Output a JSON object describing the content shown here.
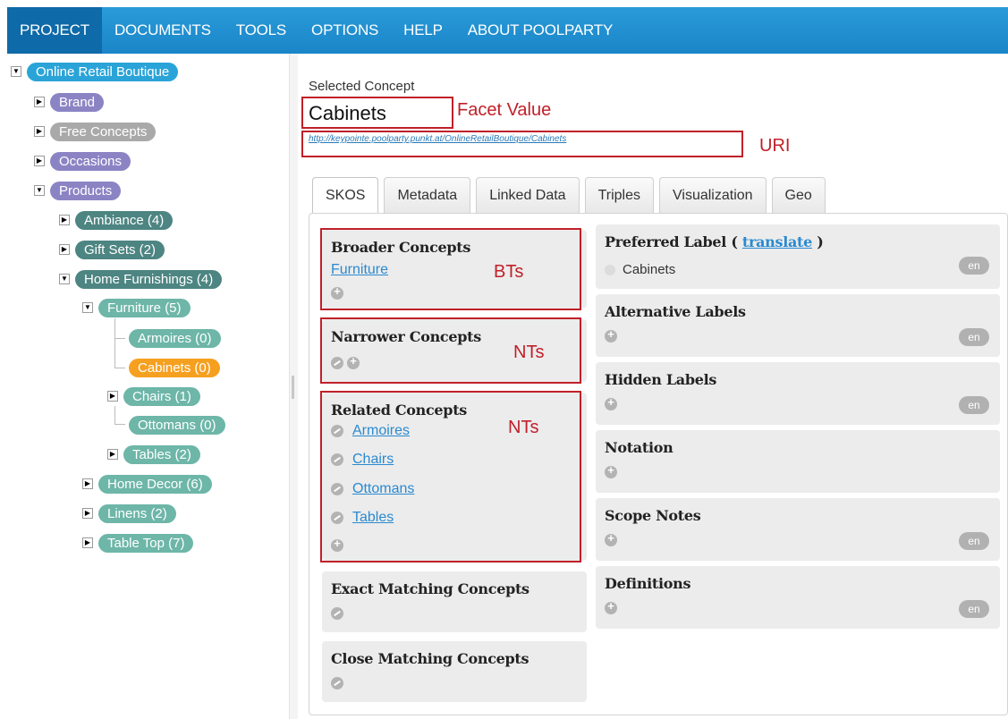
{
  "menu": [
    "PROJECT",
    "DOCUMENTS",
    "TOOLS",
    "OPTIONS",
    "HELP",
    "ABOUT POOLPARTY"
  ],
  "tree": {
    "root": "Online Retail Boutique",
    "brand": "Brand",
    "free": "Free Concepts",
    "occasions": "Occasions",
    "products": "Products",
    "ambiance": "Ambiance (4)",
    "gift_sets": "Gift Sets (2)",
    "home_furnishings": "Home Furnishings (4)",
    "furniture": "Furniture (5)",
    "armoires": "Armoires (0)",
    "cabinets": "Cabinets (0)",
    "chairs": "Chairs (1)",
    "ottomans": "Ottomans (0)",
    "tables": "Tables (2)",
    "home_decor": "Home Decor (6)",
    "linens": "Linens (2)",
    "table_top": "Table Top (7)"
  },
  "concept": {
    "selected_label": "Selected Concept",
    "title": "Cabinets",
    "uri": "http://keypointe.poolparty.punkt.at/OnlineRetailBoutique/Cabinets"
  },
  "annotations": {
    "facet": "Facet Value",
    "uri": "URI",
    "bts": "BTs",
    "nts1": "NTs",
    "nts2": "NTs"
  },
  "tabs": [
    "SKOS",
    "Metadata",
    "Linked Data",
    "Triples",
    "Visualization",
    "Geo"
  ],
  "left_cards": {
    "broader": {
      "title": "Broader Concepts",
      "items": [
        "Furniture"
      ]
    },
    "narrower": {
      "title": "Narrower Concepts"
    },
    "related": {
      "title": "Related Concepts",
      "items": [
        "Armoires",
        "Chairs",
        "Ottomans",
        "Tables"
      ]
    },
    "exact": {
      "title": "Exact Matching Concepts"
    },
    "close": {
      "title": "Close Matching Concepts"
    }
  },
  "right_cards": {
    "preferred": {
      "title_prefix": "Preferred Label ( ",
      "translate": "translate",
      "title_suffix": " )",
      "value": "Cabinets",
      "lang": "en"
    },
    "alternative": {
      "title": "Alternative Labels",
      "lang": "en"
    },
    "hidden": {
      "title": "Hidden Labels",
      "lang": "en"
    },
    "notation": {
      "title": "Notation"
    },
    "scope": {
      "title": "Scope Notes",
      "lang": "en"
    },
    "definitions": {
      "title": "Definitions",
      "lang": "en"
    }
  }
}
